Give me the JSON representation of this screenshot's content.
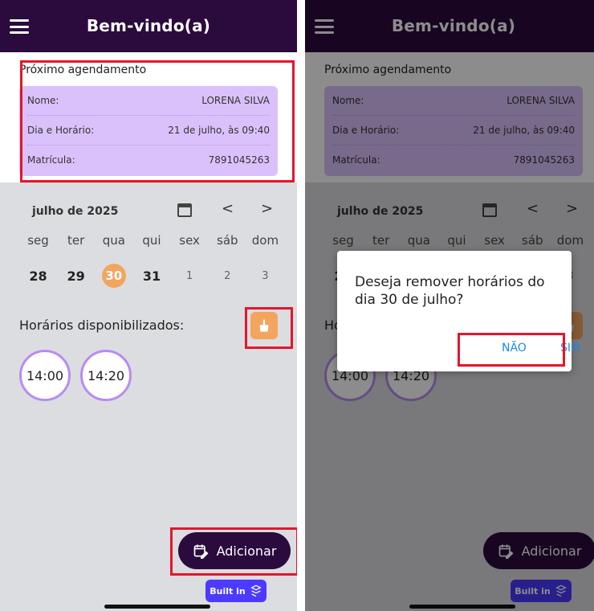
{
  "app": {
    "title": "Bem-vindo(a)"
  },
  "next_appointment": {
    "heading": "Próximo agendamento",
    "rows": [
      {
        "label": "Nome:",
        "value": "LORENA SILVA"
      },
      {
        "label": "Dia e Horário:",
        "value": "21 de julho, às 09:40"
      },
      {
        "label": "Matrícula:",
        "value": "7891045263"
      }
    ]
  },
  "calendar": {
    "month_label": "julho de 2025",
    "weekdays": [
      "seg",
      "ter",
      "qua",
      "qui",
      "sex",
      "sáb",
      "dom"
    ],
    "dates": [
      "28",
      "29",
      "30",
      "31",
      "1",
      "2",
      "3"
    ],
    "selected_index": 2
  },
  "available": {
    "heading": "Horários disponibilizados:",
    "slots": [
      "14:00",
      "14:20"
    ]
  },
  "actions": {
    "add_label": "Adicionar",
    "built_in_label": "Built in"
  },
  "dialog": {
    "message": "Deseja remover horários do dia 30 de julho?",
    "no_label": "NÃO",
    "yes_label": "SIM"
  },
  "colors": {
    "primary_dark": "#2b0a3d",
    "accent_orange": "#f3a560",
    "info_purple": "#dbc1fb",
    "slot_border": "#b88cf1",
    "highlight_red": "#e4162b",
    "dialog_button_blue": "#1e88e5",
    "built_in_blue": "#4c3aff"
  },
  "icons": {
    "menu": "hamburger-icon",
    "calendar": "calendar-icon",
    "prev": "chevron-left-icon",
    "next": "chevron-right-icon",
    "clear": "broom-icon",
    "add": "calendar-edit-icon",
    "built_in": "flutterflow-logo-icon"
  }
}
